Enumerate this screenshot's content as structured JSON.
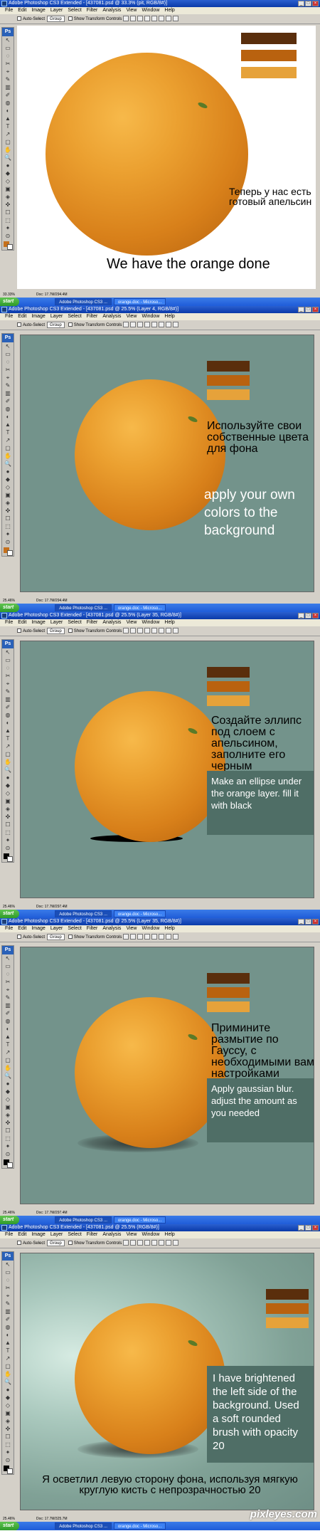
{
  "panels": [
    {
      "window_title": "Adobe Photoshop CS3 Extended - [437081.psd @ 33.3% (pit, RGB/8#)]",
      "canvas_bg": "#ffffff",
      "ru_text": "Теперь у нас есть готовый апельсин",
      "en_text": "We have the orange done",
      "status_zoom": "33.33%",
      "status_doc": "Doc: 17.7M/294.4M",
      "tb_items": [
        "Adobe Photoshop CS3 ...",
        "orange.doc - Microso..."
      ]
    },
    {
      "window_title": "Adobe Photoshop CS3 Extended - [437081.psd @ 25.5% (Layer 4, RGB/8#)]",
      "canvas_bg": "#73938b",
      "ru_text": "Используйте свои собственные цвета для фона",
      "en_text": "apply your own colors to the background",
      "status_zoom": "25.46%",
      "status_doc": "Doc: 17.7M/294.4M",
      "tb_items": [
        "Adobe Photoshop CS3 ...",
        "orange.doc - Microso..."
      ]
    },
    {
      "window_title": "Adobe Photoshop CS3 Extended - [437081.psd @ 25.5% (Layer 35, RGB/8#)]",
      "canvas_bg": "#73938b",
      "ru_text": "Создайте эллипс под слоем с апельсином, заполните его черным",
      "en_text": "Make an ellipse under the orange layer. fill it with black",
      "status_zoom": "25.46%",
      "status_doc": "Doc: 17.7M/297.4M",
      "tb_items": [
        "Adobe Photoshop CS3 ...",
        "orange.doc - Microso..."
      ]
    },
    {
      "window_title": "Adobe Photoshop CS3 Extended - [437081.psd @ 25.5% (Layer 35, RGB/8#)]",
      "canvas_bg": "#73938b",
      "ru_text": "Примините размытие по Гауссу, с необходимыми вам настройками",
      "en_text": "Apply gaussian blur. adjust the amount as you needed",
      "status_zoom": "25.46%",
      "status_doc": "Doc: 17.7M/297.4M",
      "tb_items": [
        "Adobe Photoshop CS3 ...",
        "orange.doc - Microso..."
      ]
    },
    {
      "window_title": "Adobe Photoshop CS3 Extended - [437081.psd @ 25.5% (RGB/8#)]",
      "canvas_bg": "#73938b",
      "ru_text": "Я осветлил левую сторону фона, используя мягкую круглую кисть с непрозрачностью 20",
      "en_text": "I have brightened the left side of the background. Used a soft rounded brush with opacity 20",
      "status_zoom": "25.46%",
      "status_doc": "Doc: 17.7M/325.7M",
      "tb_items": [
        "Adobe Photoshop CS3 ...",
        "orange.doc - Microso..."
      ]
    }
  ],
  "menu": [
    "File",
    "Edit",
    "Image",
    "Layer",
    "Select",
    "Filter",
    "Analysis",
    "View",
    "Window",
    "Help"
  ],
  "options": {
    "auto_select": "Auto-Select",
    "group": "Group",
    "show_transform": "Show Transform Controls"
  },
  "start_label": "start",
  "swatches": [
    "#5a2e0c",
    "#b9620f",
    "#e6a23a"
  ],
  "watermark": "pixleyes.com"
}
